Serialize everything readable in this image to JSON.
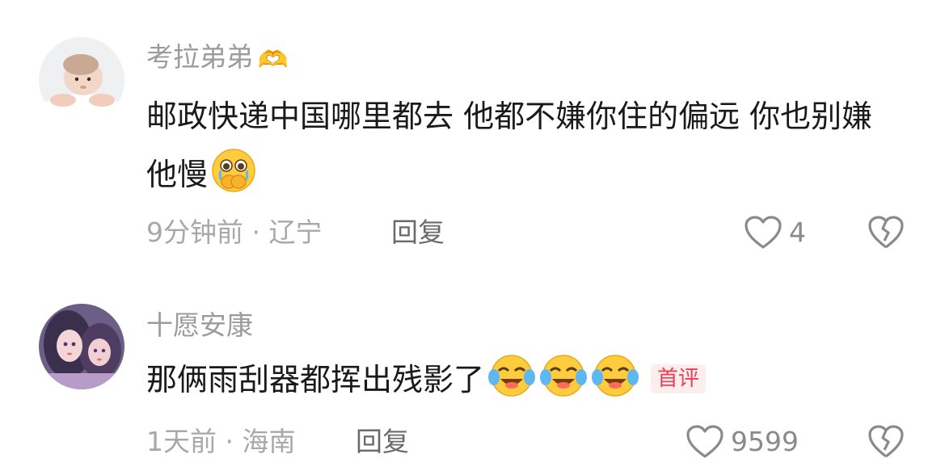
{
  "comments": [
    {
      "username": "考拉弟弟",
      "username_emoji": "🫶",
      "text": "邮政快递中国哪里都去 他都不嫌你住的偏远 你也别嫌他慢",
      "emoji_icon": "crying-face-hands-over-mouth-icon",
      "time": "9分钟前",
      "separator": "·",
      "location": "辽宁",
      "reply_label": "回复",
      "like_count": "4",
      "badge": ""
    },
    {
      "username": "十愿安康",
      "username_emoji": "",
      "text": "那俩雨刮器都挥出残影了",
      "emoji_icon": "tears-of-joy-icon",
      "emoji_repeat": 3,
      "time": "1天前",
      "separator": "·",
      "location": "海南",
      "reply_label": "回复",
      "like_count": "9599",
      "badge": "首评"
    }
  ],
  "colors": {
    "username": "#9b9b9b",
    "text": "#1a1a1a",
    "meta": "#a8a8a8",
    "badge_bg": "#fdeeee",
    "badge_text": "#ee3d55"
  }
}
